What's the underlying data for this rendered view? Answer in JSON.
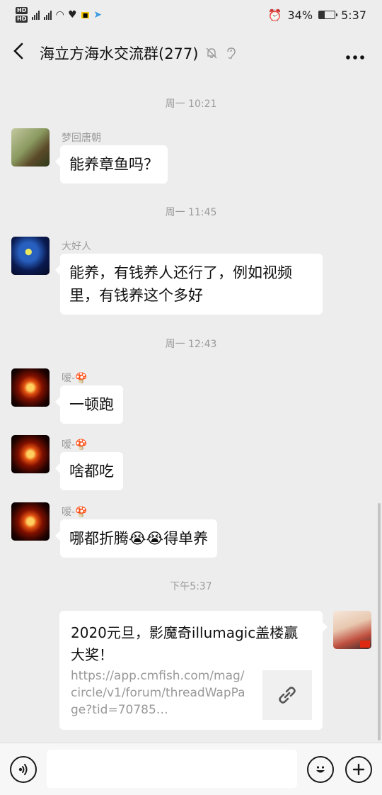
{
  "status_bar": {
    "battery": "34%",
    "time": "5:37",
    "battery_level": 0.34
  },
  "header": {
    "title": "海立方海水交流群(277)"
  },
  "messages": [
    {
      "time": "周一 10:21",
      "sender": "梦回唐朝",
      "lines": [
        "能养章鱼吗？"
      ]
    },
    {
      "time": "周一 11:45",
      "sender": "大好人",
      "lines": [
        "能养，有钱养人还行了，例如视频",
        "里，有钱养这个多好"
      ]
    },
    {
      "time": "周一 12:43",
      "sender": "嗳-🍄",
      "lines": [
        "一顿跑"
      ]
    },
    {
      "sender": "嗳-🍄",
      "lines": [
        "啥都吃"
      ]
    },
    {
      "sender": "嗳-🍄",
      "lines": [
        "哪都折腾😭😭得单养"
      ]
    }
  ],
  "link_message": {
    "time": "下午5:37",
    "title": "2020元旦，影魔奇illumagic盖楼赢大奖！",
    "url": "https://app.cmfish.com/mag/circle/v1/forum/threadWapPage?tid=70785…"
  },
  "icons": {
    "back": "back-arrow-icon",
    "mute": "bell-off-icon",
    "ear": "ear-icon",
    "more": "more-icon",
    "voice": "voice-icon",
    "emoji": "emoji-icon",
    "add": "add-icon",
    "link": "link-icon"
  }
}
